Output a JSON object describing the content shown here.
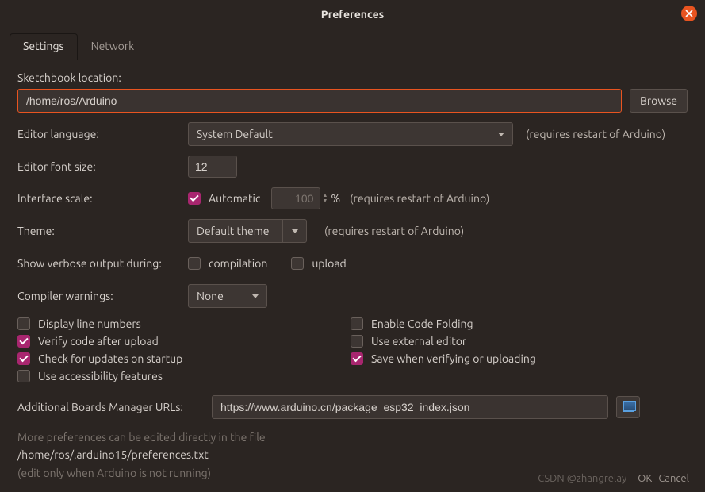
{
  "window": {
    "title": "Preferences"
  },
  "tabs": {
    "settings": "Settings",
    "network": "Network"
  },
  "labels": {
    "sketchbook": "Sketchbook location:",
    "editor_lang": "Editor language:",
    "font_size": "Editor font size:",
    "iface_scale": "Interface scale:",
    "theme": "Theme:",
    "verbose": "Show verbose output during:",
    "warnings": "Compiler warnings:",
    "boards_url": "Additional Boards Manager URLs:"
  },
  "values": {
    "sketchbook_path": "/home/ros/Arduino",
    "editor_lang": "System Default",
    "font_size": "12",
    "scale_pct": "100",
    "theme": "Default theme",
    "warnings": "None",
    "boards_url": "https://www.arduino.cn/package_esp32_index.json"
  },
  "notes": {
    "restart": "(requires restart of Arduino)"
  },
  "buttons": {
    "browse": "Browse",
    "ok": "OK",
    "cancel": "Cancel"
  },
  "checkboxes": {
    "automatic": "Automatic",
    "pct": "%",
    "compilation": "compilation",
    "upload": "upload",
    "display_line_numbers": "Display line numbers",
    "verify_after_upload": "Verify code after upload",
    "check_updates": "Check for updates on startup",
    "accessibility": "Use accessibility features",
    "code_folding": "Enable Code Folding",
    "external_editor": "Use external editor",
    "save_when_verify": "Save when verifying or uploading"
  },
  "info": {
    "more_prefs": "More preferences can be edited directly in the file",
    "prefs_path": "/home/ros/.arduino15/preferences.txt",
    "edit_only": "(edit only when Arduino is not running)"
  },
  "watermark": "CSDN @zhangrelay"
}
